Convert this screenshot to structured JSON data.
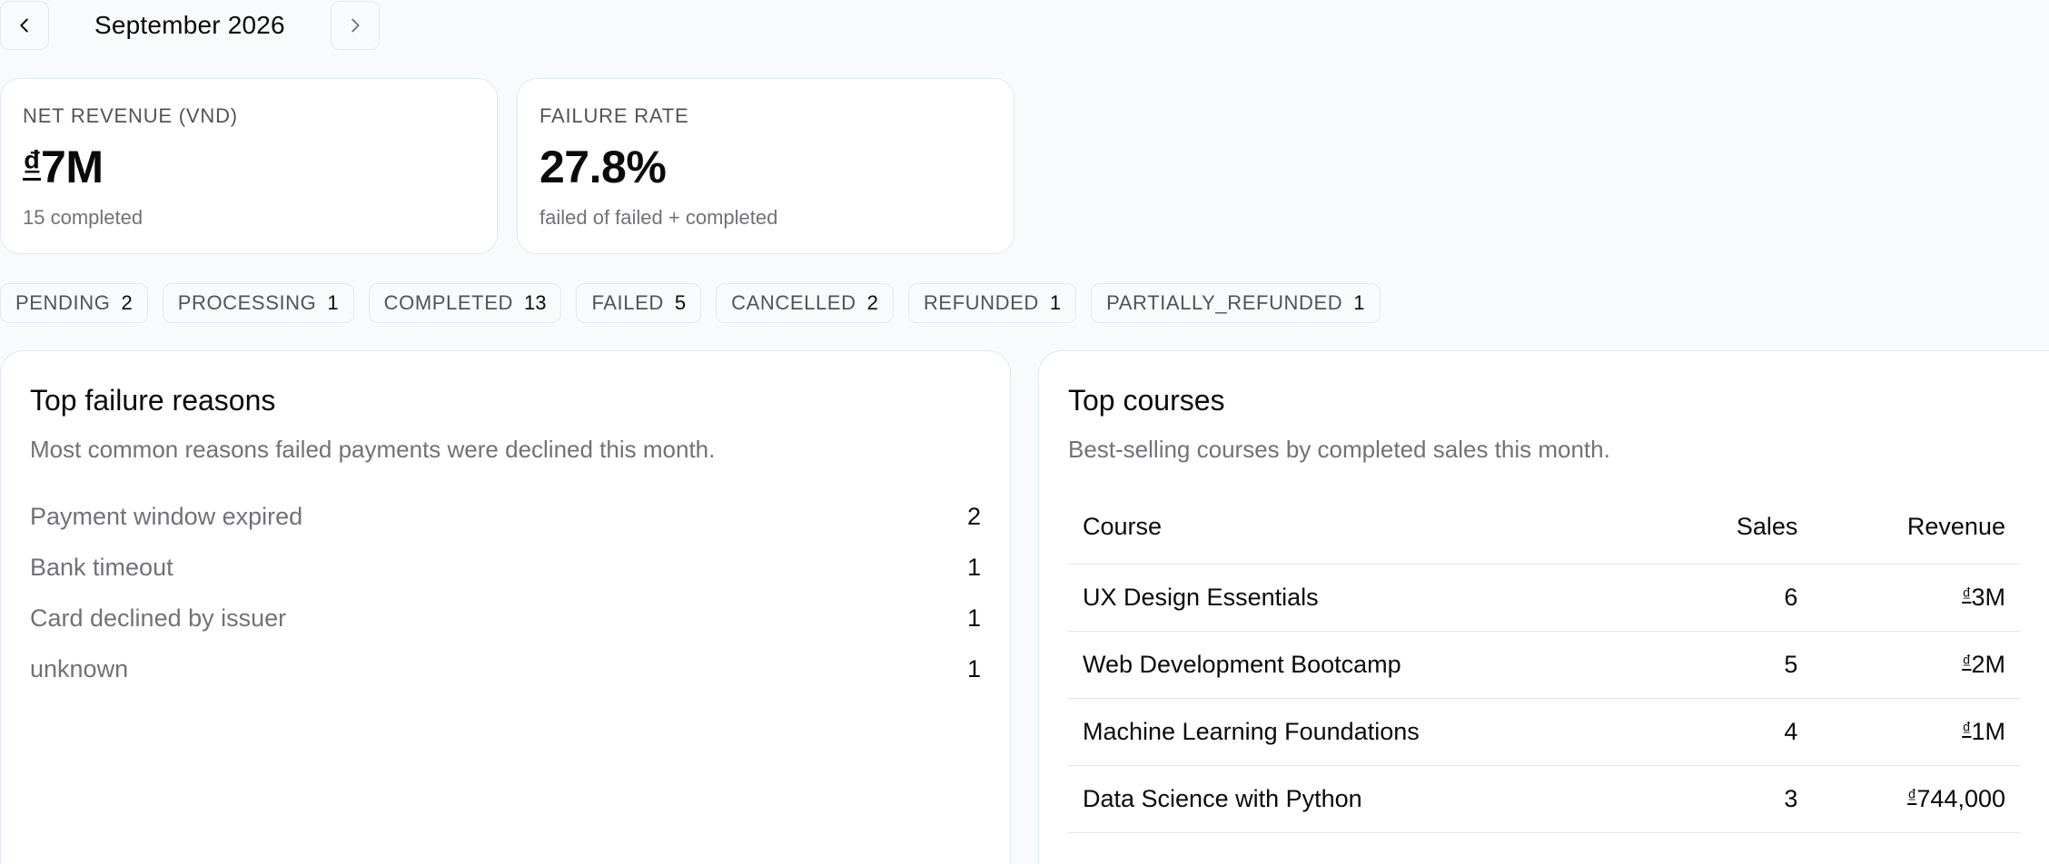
{
  "month_nav": {
    "title": "September 2026",
    "prev_icon": "chevron-left-icon",
    "next_icon": "chevron-right-icon"
  },
  "stats": {
    "revenue": {
      "label": "NET REVENUE (VND)",
      "currency_symbol": "₫",
      "value": "7M",
      "sub": "15 completed"
    },
    "failure_rate": {
      "label": "FAILURE RATE",
      "value": "27.8%",
      "sub": "failed of failed + completed"
    }
  },
  "status_chips": [
    {
      "label": "PENDING",
      "count": "2"
    },
    {
      "label": "PROCESSING",
      "count": "1"
    },
    {
      "label": "COMPLETED",
      "count": "13"
    },
    {
      "label": "FAILED",
      "count": "5"
    },
    {
      "label": "CANCELLED",
      "count": "2"
    },
    {
      "label": "REFUNDED",
      "count": "1"
    },
    {
      "label": "PARTIALLY_REFUNDED",
      "count": "1"
    }
  ],
  "failure_panel": {
    "title": "Top failure reasons",
    "description": "Most common reasons failed payments were declined this month.",
    "reasons": [
      {
        "label": "Payment window expired",
        "count": "2"
      },
      {
        "label": "Bank timeout",
        "count": "1"
      },
      {
        "label": "Card declined by issuer",
        "count": "1"
      },
      {
        "label": "unknown",
        "count": "1"
      }
    ]
  },
  "courses_panel": {
    "title": "Top courses",
    "description": "Best-selling courses by completed sales this month.",
    "columns": {
      "course": "Course",
      "sales": "Sales",
      "revenue": "Revenue"
    },
    "currency_symbol": "₫",
    "rows": [
      {
        "course": "UX Design Essentials",
        "sales": "6",
        "revenue": "3M"
      },
      {
        "course": "Web Development Bootcamp",
        "sales": "5",
        "revenue": "2M"
      },
      {
        "course": "Machine Learning Foundations",
        "sales": "4",
        "revenue": "1M"
      },
      {
        "course": "Data Science with Python",
        "sales": "3",
        "revenue": "744,000"
      }
    ]
  },
  "colors": {
    "background": "#f8fafc",
    "card": "#ffffff",
    "border": "#e2e8f0",
    "muted_text": "#71717a",
    "text": "#0a0a0a"
  }
}
